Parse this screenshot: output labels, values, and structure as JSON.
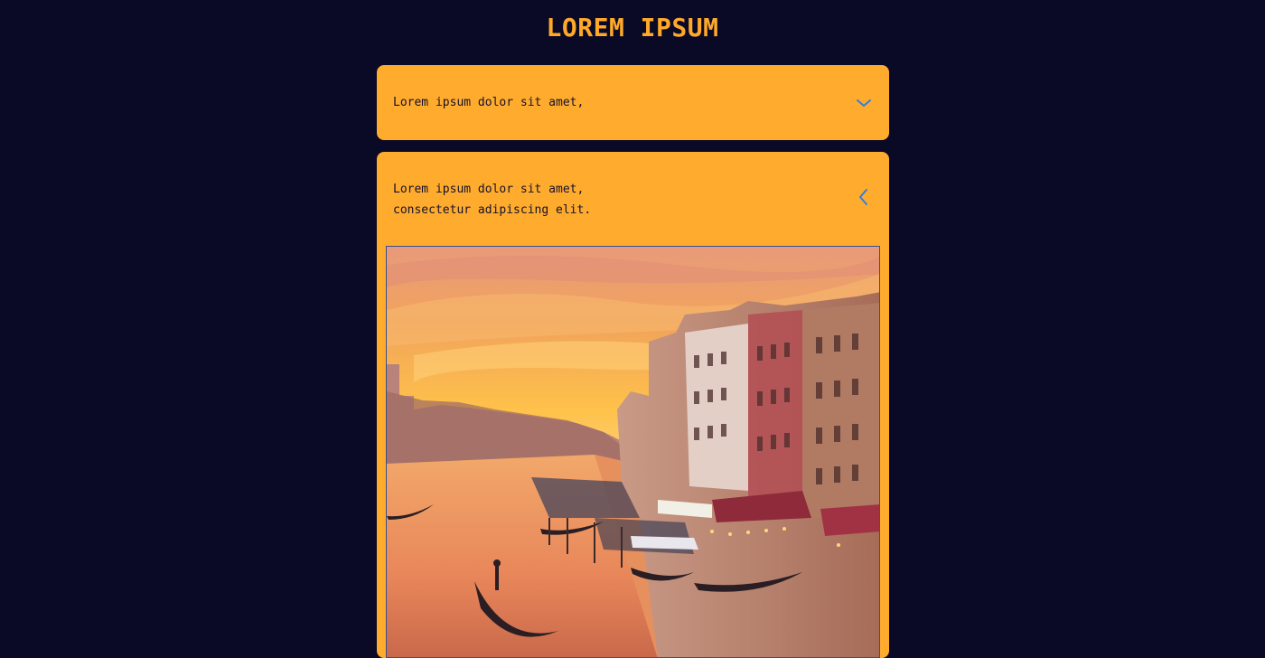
{
  "page": {
    "title": "LOREM IPSUM"
  },
  "accordion": [
    {
      "text_lines": [
        "Lorem ipsum dolor sit amet,"
      ],
      "state": "collapsed",
      "icon": "chevron-down-icon"
    },
    {
      "text_lines": [
        "Lorem ipsum dolor sit amet,",
        "consectetur adipiscing elit."
      ],
      "state": "expanded",
      "icon": "chevron-left-icon",
      "image": "venice-grand-canal-sunset"
    }
  ],
  "colors": {
    "background": "#0b0a26",
    "accent": "#ffab2d",
    "chevron": "#2f7fe0"
  }
}
